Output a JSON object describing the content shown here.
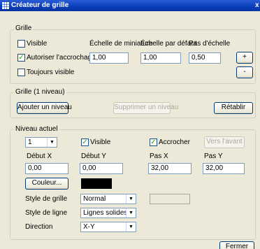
{
  "window": {
    "title": "Créateur de grille",
    "close_glyph": "x"
  },
  "grid_group": {
    "legend": "Grille",
    "visible_label": "Visible",
    "visible_checked": false,
    "snap_label": "Autoriser l'accrochage",
    "snap_checked": true,
    "always_visible_label": "Toujours visible",
    "always_visible_checked": false,
    "thumbnail_scale_label": "Échelle de miniature",
    "thumbnail_scale_value": "1,00",
    "default_scale_label": "Échelle par défaut",
    "default_scale_value": "1,00",
    "step_label": "Pas d'échelle",
    "step_value": "0,50",
    "plus_label": "+",
    "minus_label": "-"
  },
  "levels_group": {
    "legend": "Grille (1 niveau)",
    "add_label": "Ajouter un niveau",
    "remove_label": "Supprimer un niveau",
    "reset_label": "Rétablir"
  },
  "current_level": {
    "legend": "Niveau actuel",
    "level_value": "1",
    "visible_label": "Visible",
    "visible_checked": true,
    "snap_label": "Accrocher",
    "snap_checked": true,
    "forward_label": "Vers l'avant",
    "start_x_label": "Début X",
    "start_x_value": "0,00",
    "start_y_label": "Début Y",
    "start_y_value": "0,00",
    "step_x_label": "Pas X",
    "step_x_value": "32,00",
    "step_y_label": "Pas Y",
    "step_y_value": "32,00",
    "color_button_label": "Couleur...",
    "color_value": "#000000",
    "grid_style_label": "Style de grille",
    "grid_style_value": "Normal",
    "line_style_label": "Style de ligne",
    "line_style_value": "Lignes solides",
    "direction_label": "Direction",
    "direction_value": "X-Y"
  },
  "footer": {
    "close_label": "Fermer"
  }
}
